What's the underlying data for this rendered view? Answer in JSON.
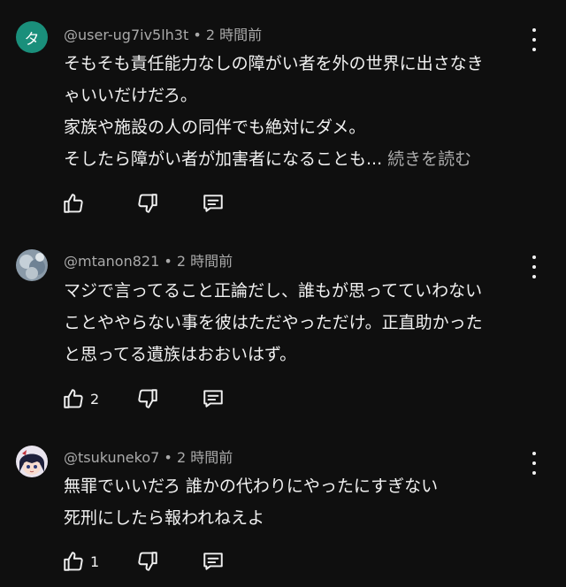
{
  "comments": [
    {
      "avatar_letter": "タ",
      "avatar_color": "#1a8f7b",
      "author": "@user-ug7iv5lh3t",
      "separator": "•",
      "time": "2 時間前",
      "lines": [
        "そもそも責任能力なしの障がい者を外の世界に出さなき",
        "ゃいいだけだろ。",
        "家族や施設の人の同伴でも絶対にダメ。",
        "そしたら障がい者が加害者になることも..."
      ],
      "read_more": "続きを読む",
      "like_count": ""
    },
    {
      "avatar_icon": "photo-avatar-icon",
      "author": "@mtanon821",
      "separator": "•",
      "time": "2 時間前",
      "lines": [
        "マジで言ってること正論だし、誰もが思ってていわない",
        "ことややらない事を彼はただやっただけ。正直助かった",
        "と思ってる遺族はおおいはず。"
      ],
      "like_count": "2"
    },
    {
      "avatar_icon": "anime-character-avatar-icon",
      "author": "@tsukuneko7",
      "separator": "•",
      "time": "2 時間前",
      "lines": [
        "無罪でいいだろ 誰かの代わりにやったにすぎない",
        "死刑にしたら報われねえよ"
      ],
      "like_count": "1"
    }
  ],
  "colors": {
    "background": "#0f0f0f",
    "text": "#f1f1f1",
    "secondary_text": "#aaaaaa"
  }
}
